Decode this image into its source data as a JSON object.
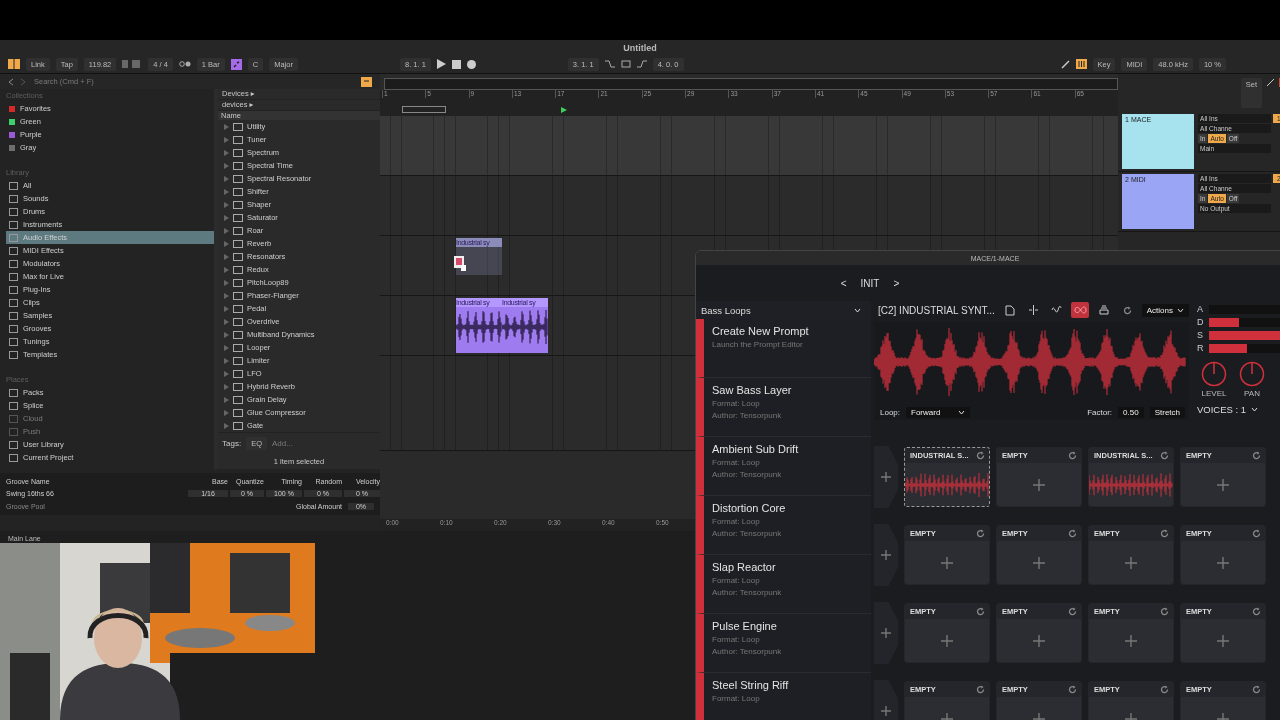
{
  "window": {
    "title": "Untitled"
  },
  "transport": {
    "link": "Link",
    "tap": "Tap",
    "tempo": "119.82",
    "signature": "4 / 4",
    "quantize": "1 Bar",
    "key": "C",
    "scale": "Major",
    "position": "8. 1. 1",
    "loop_start": "3. 1. 1",
    "loop_length": "4. 0. 0",
    "key_map": "Key",
    "midi_map": "MIDI",
    "sample_rate": "48.0 kHz",
    "cpu": "10 %"
  },
  "browser": {
    "search": {
      "placeholder": "Search (Cmd + F)"
    },
    "collections": {
      "heading": "Collections",
      "items": [
        {
          "label": "Favorites",
          "color": "#d42a2a"
        },
        {
          "label": "Green",
          "color": "#3ccf6a"
        },
        {
          "label": "Purple",
          "color": "#9a5ad8"
        },
        {
          "label": "Gray",
          "color": "#6e6e6e"
        }
      ]
    },
    "library": {
      "heading": "Library",
      "items": [
        {
          "label": "All",
          "selected": false
        },
        {
          "label": "Sounds",
          "selected": false
        },
        {
          "label": "Drums",
          "selected": false
        },
        {
          "label": "Instruments",
          "selected": false
        },
        {
          "label": "Audio Effects",
          "selected": true
        },
        {
          "label": "MIDI Effects",
          "selected": false
        },
        {
          "label": "Modulators",
          "selected": false
        },
        {
          "label": "Max for Live",
          "selected": false
        },
        {
          "label": "Plug-Ins",
          "selected": false
        },
        {
          "label": "Clips",
          "selected": false
        },
        {
          "label": "Samples",
          "selected": false
        },
        {
          "label": "Grooves",
          "selected": false
        },
        {
          "label": "Tunings",
          "selected": false
        },
        {
          "label": "Templates",
          "selected": false
        }
      ]
    },
    "places": {
      "heading": "Places",
      "items": [
        {
          "label": "Packs",
          "disabled": false
        },
        {
          "label": "Splice",
          "disabled": false
        },
        {
          "label": "Cloud",
          "disabled": true
        },
        {
          "label": "Push",
          "disabled": true
        },
        {
          "label": "User Library",
          "disabled": false
        },
        {
          "label": "Current Project",
          "disabled": false
        }
      ]
    },
    "breadcrumbs": [
      "Devices ▸",
      "devices ▸"
    ],
    "column": "Name",
    "devices": [
      "Utility",
      "Tuner",
      "Spectrum",
      "Spectral Time",
      "Spectral Resonator",
      "Shifter",
      "Shaper",
      "Saturator",
      "Roar",
      "Reverb",
      "Resonators",
      "Redux",
      "PitchLoop89",
      "Phaser-Flanger",
      "Pedal",
      "Overdrive",
      "Multiband Dynamics",
      "Looper",
      "Limiter",
      "LFO",
      "Hybrid Reverb",
      "Grain Delay",
      "Glue Compressor",
      "Gate"
    ],
    "tags": {
      "label": "Tags:",
      "tag": "EQ",
      "placeholder": "Add..."
    },
    "status": "1 item selected"
  },
  "groove_pool": {
    "columns": [
      "Groove Name",
      "Base",
      "Quantize",
      "Timing",
      "Random",
      "Velocity"
    ],
    "row": {
      "name": "Swing 16ths 66",
      "base": "1/16",
      "quantize": "0 %",
      "timing": "100 %",
      "random": "0 %",
      "velocity": "0 %"
    },
    "title": "Groove Pool",
    "global_label": "Global Amount",
    "global_value": "0%"
  },
  "main_lane": "Main Lane",
  "arrangement": {
    "bars": [
      "1",
      "5",
      "9",
      "13",
      "17",
      "21",
      "25",
      "29",
      "33",
      "37",
      "41",
      "45",
      "49",
      "53",
      "57",
      "61",
      "65"
    ],
    "times": [
      "0:00",
      "0:10",
      "0:20",
      "0:30",
      "0:40",
      "0:50"
    ],
    "ghost_clip": {
      "label": "Industrial sy"
    },
    "clips": [
      {
        "label": "Industrial sy"
      },
      {
        "label": "Industrial sy"
      }
    ]
  },
  "tracks": {
    "set": "Set",
    "items": [
      {
        "name": "1 MACE",
        "color": "#a6e3ef",
        "input": "All Ins",
        "channel": "All Channe",
        "monitor": [
          {
            "label": "In",
            "selected": false
          },
          {
            "label": "Auto",
            "selected": true
          },
          {
            "label": "Off",
            "selected": false
          }
        ],
        "output": "Main",
        "number": "1"
      },
      {
        "name": "2 MIDI",
        "color": "#9aa6f5",
        "input": "All Ins",
        "channel": "All Channe",
        "monitor": [
          {
            "label": "In",
            "selected": false
          },
          {
            "label": "Auto",
            "selected": true
          },
          {
            "label": "Off",
            "selected": false
          }
        ],
        "output": "No Output",
        "number": "2"
      }
    ]
  },
  "plugin": {
    "title": "MACE/1-MACE",
    "prev": "<",
    "preset": "INIT",
    "next": ">",
    "category": "Bass Loops",
    "prompts": [
      {
        "name": "Create New Prompt",
        "lines": [
          "Launch the Prompt Editor"
        ]
      },
      {
        "name": "Saw Bass Layer",
        "lines": [
          "Format: Loop",
          "Author: Tensorpunk"
        ]
      },
      {
        "name": "Ambient Sub Drift",
        "lines": [
          "Format: Loop",
          "Author: Tensorpunk"
        ]
      },
      {
        "name": "Distortion Core",
        "lines": [
          "Format: Loop",
          "Author: Tensorpunk"
        ]
      },
      {
        "name": "Slap Reactor",
        "lines": [
          "Format: Loop",
          "Author: Tensorpunk"
        ]
      },
      {
        "name": "Pulse Engine",
        "lines": [
          "Format: Loop",
          "Author: Tensorpunk"
        ]
      },
      {
        "name": "Steel String Riff",
        "lines": [
          "Format: Loop"
        ]
      }
    ],
    "sample": {
      "title": "[C2] INDUSTRIAL SYNT...",
      "tools": [
        {
          "kind": "file",
          "on": false
        },
        {
          "kind": "split",
          "on": false
        },
        {
          "kind": "wave",
          "on": false
        },
        {
          "kind": "loop",
          "on": true
        },
        {
          "kind": "stack",
          "on": false
        },
        {
          "kind": "refresh",
          "on": false
        }
      ],
      "actions": "Actions",
      "loop_label": "Loop:",
      "loop_mode": "Forward",
      "factor_label": "Factor:",
      "factor": "0.50",
      "stretch": "Stretch"
    },
    "envelope": [
      {
        "label": "A",
        "level": 0
      },
      {
        "label": "D",
        "level": 0.35
      },
      {
        "label": "S",
        "level": 1
      },
      {
        "label": "R",
        "level": 0.45
      }
    ],
    "knobs": [
      "LEVEL",
      "PAN"
    ],
    "voices": "VOICES : 1",
    "slot_rows": [
      [
        {
          "name": "INDUSTRIAL S...",
          "filled": true,
          "selected": true
        },
        {
          "name": "EMPTY",
          "filled": false,
          "selected": false
        },
        {
          "name": "INDUSTRIAL S...",
          "filled": true,
          "selected": false
        },
        {
          "name": "EMPTY",
          "filled": false,
          "selected": false
        }
      ],
      [
        {
          "name": "EMPTY",
          "filled": false,
          "selected": false
        },
        {
          "name": "EMPTY",
          "filled": false,
          "selected": false
        },
        {
          "name": "EMPTY",
          "filled": false,
          "selected": false
        },
        {
          "name": "EMPTY",
          "filled": false,
          "selected": false
        }
      ],
      [
        {
          "name": "EMPTY",
          "filled": false,
          "selected": false
        },
        {
          "name": "EMPTY",
          "filled": false,
          "selected": false
        },
        {
          "name": "EMPTY",
          "filled": false,
          "selected": false
        },
        {
          "name": "EMPTY",
          "filled": false,
          "selected": false
        }
      ],
      [
        {
          "name": "EMPTY",
          "filled": false,
          "selected": false
        },
        {
          "name": "EMPTY",
          "filled": false,
          "selected": false
        },
        {
          "name": "EMPTY",
          "filled": false,
          "selected": false
        },
        {
          "name": "EMPTY",
          "filled": false,
          "selected": false
        }
      ]
    ]
  }
}
